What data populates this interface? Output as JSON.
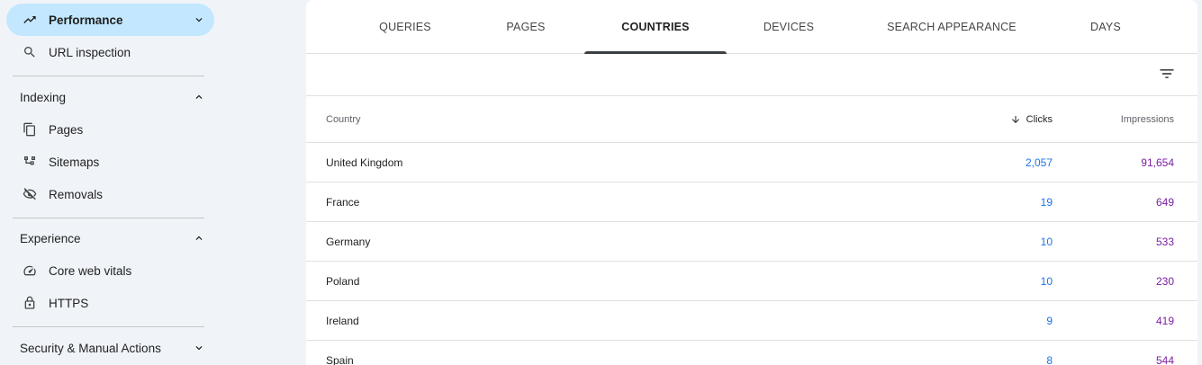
{
  "sidebar": {
    "performance": {
      "label": "Performance",
      "icon": "trending-up-icon"
    },
    "url_inspection": {
      "label": "URL inspection",
      "icon": "search-icon"
    },
    "indexing": {
      "title": "Indexing",
      "items": [
        {
          "label": "Pages",
          "icon": "pages-icon"
        },
        {
          "label": "Sitemaps",
          "icon": "sitemap-icon"
        },
        {
          "label": "Removals",
          "icon": "visibility-off-icon"
        }
      ]
    },
    "experience": {
      "title": "Experience",
      "items": [
        {
          "label": "Core web vitals",
          "icon": "speed-gauge-icon"
        },
        {
          "label": "HTTPS",
          "icon": "lock-icon"
        }
      ]
    },
    "security": {
      "title": "Security & Manual Actions"
    }
  },
  "tabs": [
    "QUERIES",
    "PAGES",
    "COUNTRIES",
    "DEVICES",
    "SEARCH APPEARANCE",
    "DAYS"
  ],
  "active_tab": "COUNTRIES",
  "table": {
    "headers": {
      "country": "Country",
      "clicks": "Clicks",
      "impressions": "Impressions"
    },
    "rows": [
      {
        "country": "United Kingdom",
        "clicks": "2,057",
        "impressions": "91,654"
      },
      {
        "country": "France",
        "clicks": "19",
        "impressions": "649"
      },
      {
        "country": "Germany",
        "clicks": "10",
        "impressions": "533"
      },
      {
        "country": "Poland",
        "clicks": "10",
        "impressions": "230"
      },
      {
        "country": "Ireland",
        "clicks": "9",
        "impressions": "419"
      },
      {
        "country": "Spain",
        "clicks": "8",
        "impressions": "544"
      }
    ]
  },
  "colors": {
    "active_nav_bg": "#c2e7ff",
    "clicks": "#1a73e8",
    "impressions": "#7b1fa2",
    "page_bg": "#f0f4f9"
  }
}
